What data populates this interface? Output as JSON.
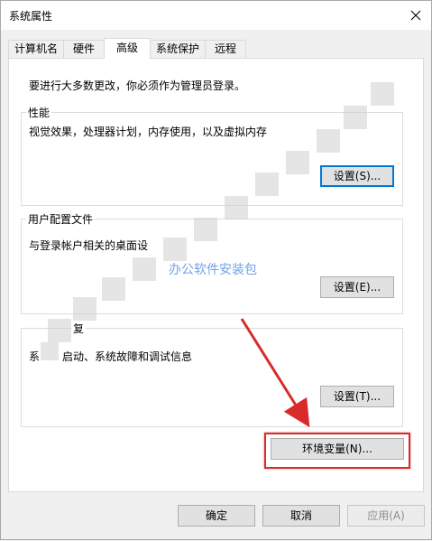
{
  "window": {
    "title": "系统属性"
  },
  "tabs": [
    {
      "label": "计算机名",
      "active": false
    },
    {
      "label": "硬件",
      "active": false
    },
    {
      "label": "高级",
      "active": true
    },
    {
      "label": "系统保护",
      "active": false
    },
    {
      "label": "远程",
      "active": false
    }
  ],
  "panel": {
    "note": "要进行大多数更改，你必须作为管理员登录。",
    "performance": {
      "title": "性能",
      "desc": "视觉效果，处理器计划，内存使用，以及虚拟内存",
      "button": "设置(S)..."
    },
    "profile": {
      "title": "用户配置文件",
      "desc": "与登录帐户相关的桌面设",
      "button": "设置(E)..."
    },
    "startup": {
      "title": "复",
      "desc_a": "系",
      "desc_b": "启动、系统故障和调试信息",
      "button": "设置(T)..."
    },
    "env_button": "环境变量(N)..."
  },
  "watermark": "办公软件安装包",
  "footer": {
    "ok": "确定",
    "cancel": "取消",
    "apply": "应用(A)"
  },
  "colors": {
    "highlight": "#d92b2b",
    "focus": "#0078d7",
    "watermark": "#6fa2ea"
  }
}
